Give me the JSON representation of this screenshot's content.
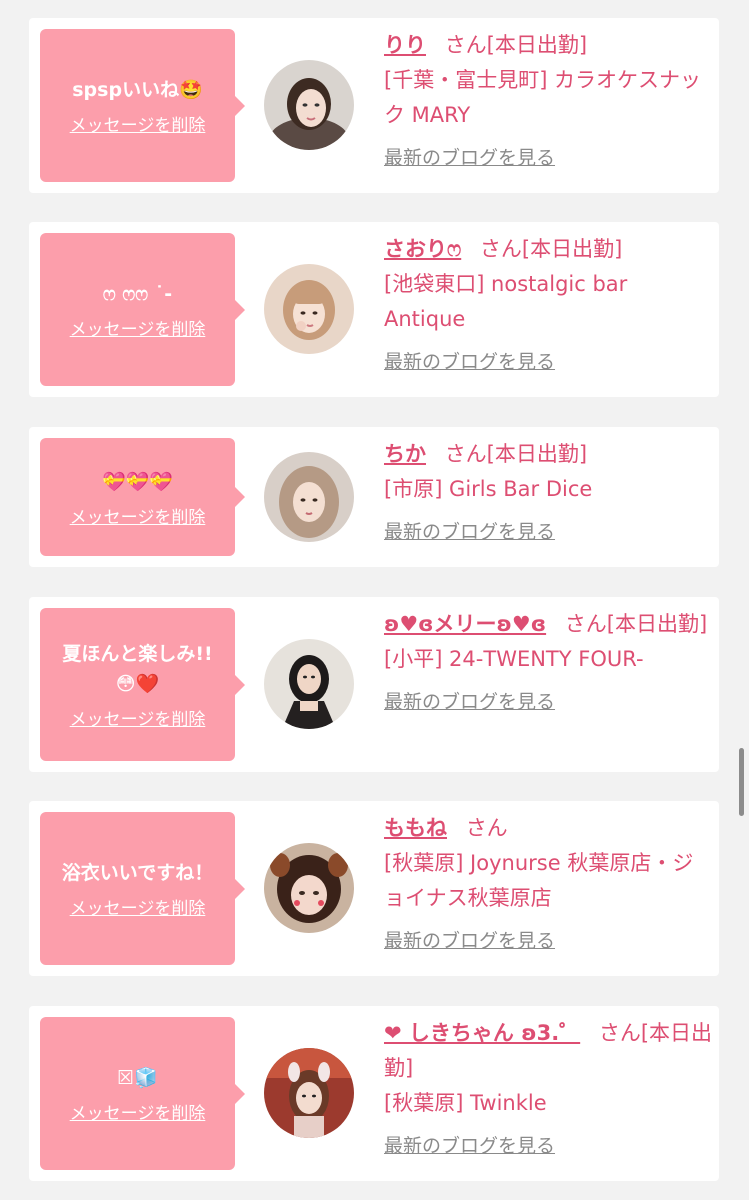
{
  "common": {
    "delete_label": "メッセージを削除",
    "blog_label": "最新のブログを見る",
    "bubble_color": "#fc9eab",
    "accent_color": "#dd4e72"
  },
  "items": [
    {
      "message": "spspいいね🤩",
      "name": "りり",
      "suffix": "さん[本日出勤]",
      "shop": "[千葉・富士見町] カラオケスナック MARY",
      "avatar_icon": "girl-photo-1"
    },
    {
      "message": "ෆ ෆෆ ˙-",
      "name": "さおりෆ",
      "suffix": "さん[本日出勤]",
      "shop": "[池袋東口] nostalgic bar Antique",
      "avatar_icon": "girl-photo-2"
    },
    {
      "message": "💝💝💝",
      "name": "ちか",
      "suffix": "さん[本日出勤]",
      "shop": "[市原] Girls Bar Dice",
      "avatar_icon": "girl-photo-3"
    },
    {
      "message": "夏ほんと楽しみ!!\n😳❤️",
      "name": "ʚ♥ɞメリーʚ♥ɞ",
      "suffix": "さん[本日出勤]",
      "shop": "[小平] 24-TWENTY FOUR-",
      "avatar_icon": "girl-photo-4"
    },
    {
      "message": "浴衣いいですね！",
      "name": "ももね",
      "suffix": "さん",
      "shop": "[秋葉原] Joynurse 秋葉原店・ジョイナス秋葉原店",
      "avatar_icon": "girl-photo-5"
    },
    {
      "message": "☒🧊",
      "name": "❤ しきちゃん ʚ3.゜",
      "suffix": "さん[本日出勤]",
      "shop": "[秋葉原] Twinkle",
      "avatar_icon": "girl-photo-6"
    }
  ]
}
